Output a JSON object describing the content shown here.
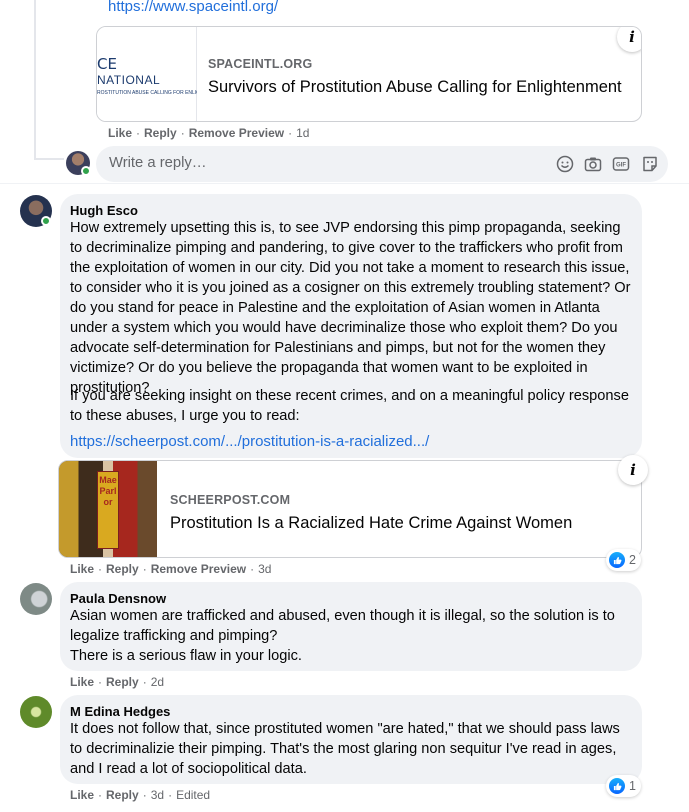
{
  "top_comment": {
    "link": "https://www.spaceintl.org/",
    "preview": {
      "logo_line1": "CE",
      "logo_line2": "NATIONAL",
      "logo_line3": "ROSTITUTION ABUSE CALLING FOR ENLIGHTEN",
      "domain": "SPACEINTL.ORG",
      "title": "Survivors of Prostitution Abuse Calling for Enlightenment"
    },
    "actions": {
      "like": "Like",
      "reply": "Reply",
      "remove_preview": "Remove Preview",
      "time": "1d"
    }
  },
  "reply_box": {
    "placeholder": "Write a reply…"
  },
  "comments": [
    {
      "author": "Hugh Esco",
      "paragraph1": "How extremely upsetting this is, to see JVP endorsing this pimp propaganda, seeking to decriminalize pimping and pandering, to give cover to the traffickers who profit from the exploitation of women in our city. Did you not take a moment to research this issue, to consider who it is you joined as a cosigner on this extremely troubling statement? Or do you stand for peace in Palestine and the exploitation of Asian women in Atlanta under a system which you would have decriminalize those who exploit them? Do you advocate self-determination for Palestinians and pimps, but not for the women they victimize? Or do you believe the propaganda that women want to be exploited in prostitution?",
      "paragraph2": "If you are seeking insight on these recent crimes, and on a meaningful policy response to these abuses, I urge you to read:",
      "link": "https://scheerpost.com/.../prostitution-is-a-racialized.../",
      "preview": {
        "domain": "SCHEERPOST.COM",
        "title": "Prostitution Is a Racialized Hate Crime Against Women",
        "sign_text": "Mae Parlor"
      },
      "actions": {
        "like": "Like",
        "reply": "Reply",
        "remove_preview": "Remove Preview",
        "time": "3d"
      },
      "reaction_count": "2"
    },
    {
      "author": "Paula Densnow",
      "line1": "Asian women are trafficked and abused, even though it is illegal, so the solution is to",
      "line2": "legalize trafficking and pimping?",
      "line3": "There is a serious flaw in your logic.",
      "actions": {
        "like": "Like",
        "reply": "Reply",
        "time": "2d"
      }
    },
    {
      "author": "M Edina Hedges",
      "text": "It does not follow that, since prostituted women \"are hated,\" that we should pass laws to decriminalizie their pimping. That's the most glaring non sequitur I've read in ages, and I read a lot of sociopolitical data.",
      "actions": {
        "like": "Like",
        "reply": "Reply",
        "time": "3d",
        "edited": "Edited"
      },
      "reaction_count": "1"
    }
  ],
  "icons": [
    "info-icon",
    "emoji-icon",
    "camera-icon",
    "gif-icon",
    "sticker-icon",
    "like-reaction-icon"
  ],
  "colors": {
    "link": "#216fdb",
    "bubble": "#f0f2f5",
    "meta": "#65676b",
    "online": "#31a24c",
    "like": "#0866ff"
  }
}
